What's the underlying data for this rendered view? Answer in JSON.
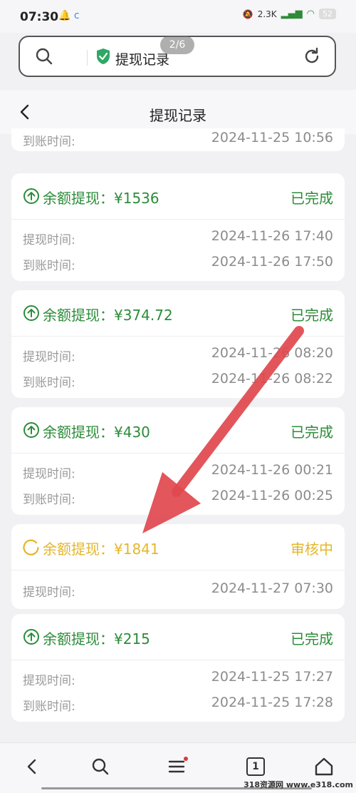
{
  "status_bar": {
    "time": "07:30",
    "left_icons": "🔔 c",
    "net_speed": "2.3K",
    "battery": "52"
  },
  "search_bar": {
    "query": "提现记录",
    "page_counter": "2/6"
  },
  "header": {
    "title": "提现记录"
  },
  "partial_row": {
    "label": "到账时间:",
    "value": "2024-11-25 10:56"
  },
  "records": [
    {
      "amount": "余额提现：¥1536",
      "status": "已完成",
      "status_color": "#2c8c3a",
      "rows": [
        {
          "label": "提现时间:",
          "value": "2024-11-26 17:40"
        },
        {
          "label": "到账时间:",
          "value": "2024-11-26 17:50"
        }
      ]
    },
    {
      "amount": "余额提现：¥374.72",
      "status": "已完成",
      "status_color": "#2c8c3a",
      "rows": [
        {
          "label": "提现时间:",
          "value": "2024-11-26 08:20"
        },
        {
          "label": "到账时间:",
          "value": "2024-11-26 08:22"
        }
      ]
    },
    {
      "amount": "余额提现：¥430",
      "status": "已完成",
      "status_color": "#2c8c3a",
      "rows": [
        {
          "label": "提现时间:",
          "value": "2024-11-26 00:21"
        },
        {
          "label": "到账时间:",
          "value": "2024-11-26 00:25"
        }
      ]
    },
    {
      "amount": "余额提现：¥1841",
      "status": "审核中",
      "status_color": "#e5b62a",
      "rows": [
        {
          "label": "提现时间:",
          "value": "2024-11-27 07:30"
        }
      ]
    },
    {
      "amount": "余额提现：¥215",
      "status": "已完成",
      "status_color": "#2c8c3a",
      "rows": [
        {
          "label": "提现时间:",
          "value": "2024-11-25 17:27"
        },
        {
          "label": "到账时间:",
          "value": "2024-11-25 17:28"
        }
      ]
    }
  ],
  "bottom_nav": {
    "tab_count": "1"
  },
  "watermark": "318资源网 www.e318.com"
}
